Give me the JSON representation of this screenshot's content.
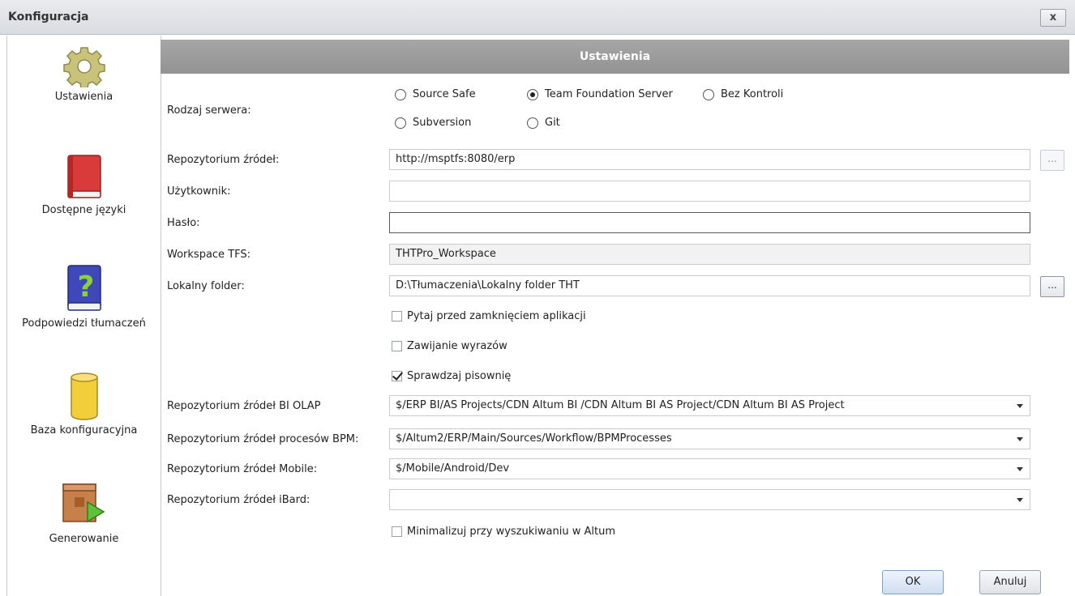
{
  "window": {
    "title": "Konfiguracja",
    "close_label": "x"
  },
  "sidebar": {
    "items": [
      {
        "label": "Ustawienia",
        "icon": "gear-icon"
      },
      {
        "label": "Dostępne języki",
        "icon": "book-red-icon"
      },
      {
        "label": "Podpowiedzi tłumaczeń",
        "icon": "help-book-icon"
      },
      {
        "label": "Baza konfiguracyjna",
        "icon": "database-icon"
      },
      {
        "label": "Generowanie",
        "icon": "box-play-icon"
      }
    ]
  },
  "main": {
    "header": "Ustawienia",
    "server_type": {
      "label": "Rodzaj serwera:",
      "options": [
        "Source Safe",
        "Team Foundation Server",
        "Bez Kontroli",
        "Subversion",
        "Git"
      ],
      "selected": "Team Foundation Server"
    },
    "fields": {
      "repo": {
        "label": "Repozytorium źródeł:",
        "value": "http://msptfs:8080/erp",
        "browse": "..."
      },
      "user": {
        "label": "Użytkownik:",
        "value": ""
      },
      "password": {
        "label": "Hasło:",
        "value": ""
      },
      "workspace": {
        "label": "Workspace TFS:",
        "value": "THTPro_Workspace"
      },
      "local_folder": {
        "label": "Lokalny folder:",
        "value": "D:\\Tłumaczenia\\Lokalny folder THT",
        "browse": "..."
      }
    },
    "checkboxes": [
      {
        "label": "Pytaj przed zamknięciem aplikacji",
        "checked": false
      },
      {
        "label": "Zawijanie wyrazów",
        "checked": false
      },
      {
        "label": "Sprawdzaj pisownię",
        "checked": true
      }
    ],
    "dropdowns": {
      "bi_olap": {
        "label": "Repozytorium źródeł BI OLAP",
        "value": "$/ERP BI/AS Projects/CDN Altum BI /CDN Altum BI  AS Project/CDN Altum BI  AS Project"
      },
      "bpm": {
        "label": "Repozytorium źródeł procesów BPM:",
        "value": "$/Altum2/ERP/Main/Sources/Workflow/BPMProcesses"
      },
      "mobile": {
        "label": "Repozytorium źródeł Mobile:",
        "value": "$/Mobile/Android/Dev"
      },
      "ibard": {
        "label": "Repozytorium źródeł iBard:",
        "value": ""
      }
    },
    "minimize_checkbox": {
      "label": "Minimalizuj przy wyszukiwaniu w Altum",
      "checked": false
    },
    "buttons": {
      "ok": "OK",
      "cancel": "Anuluj"
    }
  }
}
